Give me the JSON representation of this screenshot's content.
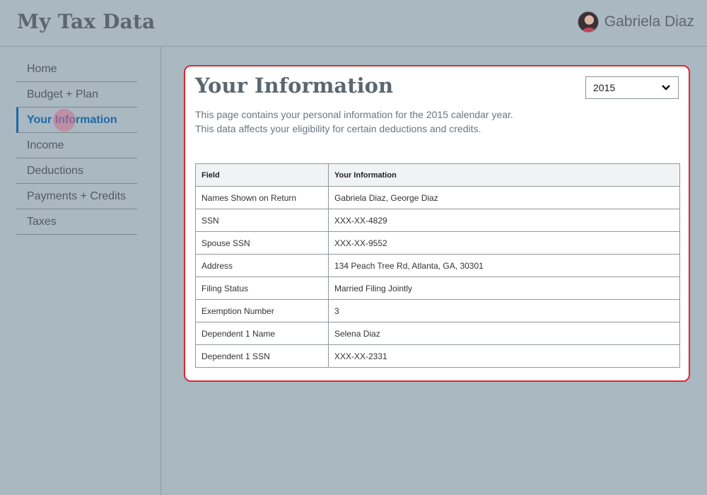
{
  "header": {
    "app_title": "My Tax Data",
    "user_name": "Gabriela Diaz"
  },
  "sidebar": {
    "items": [
      {
        "label": "Home",
        "active": false
      },
      {
        "label": "Budget + Plan",
        "active": false
      },
      {
        "label": "Your Information",
        "active": true
      },
      {
        "label": "Income",
        "active": false
      },
      {
        "label": "Deductions",
        "active": false
      },
      {
        "label": "Payments + Credits",
        "active": false
      },
      {
        "label": "Taxes",
        "active": false
      }
    ]
  },
  "main": {
    "title": "Your Information",
    "description_line1": "This page contains your personal information for the 2015 calendar year.",
    "description_line2": "This data affects your eligibility for certain deductions and credits.",
    "year_select": {
      "value": "2015"
    },
    "table": {
      "headers": [
        "Field",
        "Your Information"
      ],
      "rows": [
        [
          "Names Shown on Return",
          "Gabriela Diaz, George Diaz"
        ],
        [
          "SSN",
          "XXX-XX-4829"
        ],
        [
          "Spouse SSN",
          "XXX-XX-9552"
        ],
        [
          "Address",
          "134 Peach Tree Rd, Atlanta, GA, 30301"
        ],
        [
          "Filing Status",
          "Married Filing Jointly"
        ],
        [
          "Exemption Number",
          "3"
        ],
        [
          "Dependent 1 Name",
          "Selena Diaz"
        ],
        [
          "Dependent 1 SSN",
          "XXX-XX-2331"
        ]
      ]
    }
  },
  "colors": {
    "background": "#aab8c2",
    "accent": "#1f69a8",
    "highlight_border": "#e0282f"
  },
  "icons": {
    "select": "chevron-down-icon",
    "avatar": "user-avatar"
  }
}
